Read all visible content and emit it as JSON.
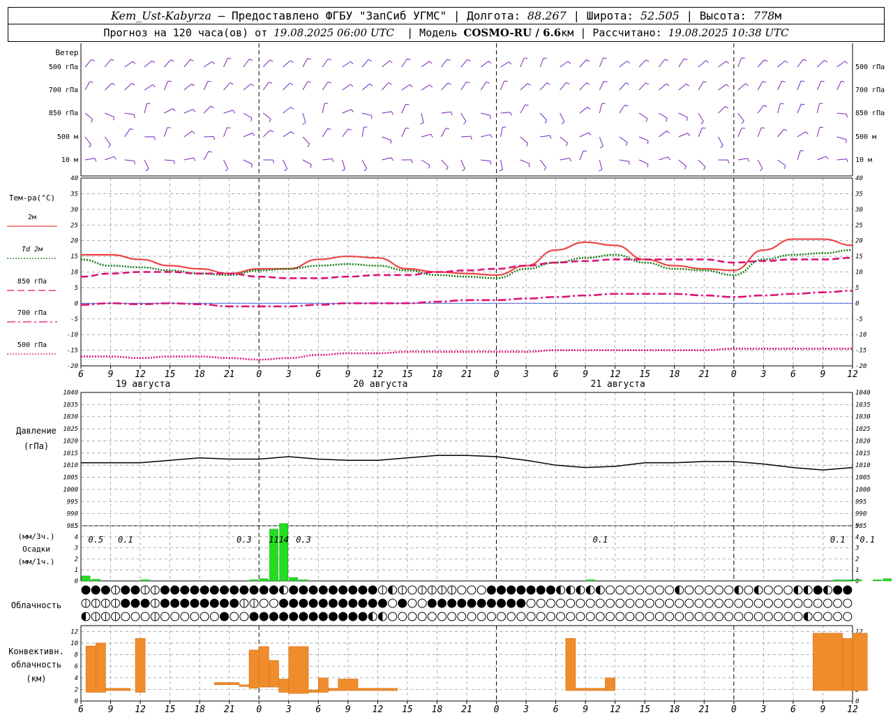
{
  "header": {
    "station": "Kem_Ust-Kabyrza",
    "sep": " – ",
    "provider": "Предоставлено ФГБУ \"ЗапСиб УГМС\"",
    "lon_label": "Долгота:",
    "lon": "88.267",
    "lat_label": "Широта:",
    "lat": "52.505",
    "alt_label": "Высота:",
    "alt": "778",
    "alt_unit": "м",
    "forecast_label": "Прогноз на 120 часа(ов) от",
    "forecast_time": "19.08.2025 06:00 UTC",
    "model_label": "Модель",
    "model": "COSMO-RU / 6.6",
    "model_unit": "км",
    "calc_label": "Рассчитано:",
    "calc_time": "19.08.2025 10:38 UTC"
  },
  "chart_data": [
    {
      "type": "wind-barbs",
      "label": "Ветер",
      "levels": [
        "500 гПа",
        "700 гПа",
        "850 гПа",
        "500 м",
        "10 м"
      ]
    },
    {
      "type": "line",
      "ylabel": "Тем-ра(°C)",
      "ylim": [
        -20,
        40
      ],
      "yticks": [
        -20,
        -15,
        -10,
        -5,
        0,
        5,
        10,
        15,
        20,
        25,
        30,
        35,
        40
      ],
      "x_hours": [
        6,
        9,
        12,
        15,
        18,
        21,
        0,
        3,
        6,
        9,
        12,
        15,
        18,
        21,
        0,
        3,
        6,
        9,
        12,
        15,
        18,
        21,
        0,
        3,
        6,
        9,
        12
      ],
      "dates": [
        {
          "label": "19 августа",
          "x_index": 2
        },
        {
          "label": "20 августа",
          "x_index": 10
        },
        {
          "label": "21 августа",
          "x_index": 18
        }
      ],
      "series": [
        {
          "name": "2м",
          "color": "#ee4444",
          "dash": "solid",
          "values": [
            15.5,
            15.5,
            14,
            12,
            11,
            9.5,
            11,
            11,
            14,
            15,
            14.5,
            11,
            10,
            9.5,
            9,
            12,
            17,
            19.5,
            18.5,
            14,
            12,
            11,
            10.5,
            17,
            20.5,
            20.5,
            18.5
          ]
        },
        {
          "name": "Td  2м",
          "color": "#117711",
          "dash": "dot",
          "values": [
            14,
            12,
            11.5,
            10.5,
            9.5,
            9,
            10.5,
            11,
            12,
            12.5,
            12,
            10.5,
            9,
            8.5,
            8,
            11,
            13,
            14.5,
            15.5,
            13,
            11,
            10.5,
            9,
            14,
            15.5,
            16,
            17
          ]
        },
        {
          "name": "850 гПа",
          "color": "#dd1177",
          "dash": "dash",
          "values": [
            8.5,
            9.5,
            10,
            10,
            9.5,
            9.5,
            8.5,
            8,
            8,
            8.5,
            9,
            9,
            10,
            10.5,
            11,
            12,
            13,
            13.5,
            14,
            14,
            14,
            14,
            13,
            13.5,
            14,
            14,
            14.5
          ]
        },
        {
          "name": "700 гПа",
          "color": "#dd1177",
          "dash": "dashdot",
          "values": [
            -0.5,
            0,
            -0.3,
            0,
            -0.3,
            -1,
            -1,
            -1,
            -0.5,
            0,
            0,
            0,
            0.5,
            1,
            1,
            1.5,
            2,
            2.5,
            3,
            3,
            3,
            2.5,
            2,
            2.5,
            3,
            3.5,
            4
          ]
        },
        {
          "name": "500 гПа",
          "color": "#dd1177",
          "dash": "dot",
          "values": [
            -17,
            -17,
            -17.5,
            -17,
            -17,
            -17.5,
            -18,
            -17.5,
            -16.5,
            -16,
            -16,
            -15.5,
            -15.5,
            -15.5,
            -15.5,
            -15.5,
            -15,
            -15,
            -15,
            -15,
            -15,
            -15,
            -14.5,
            -14.5,
            -14.5,
            -14.5,
            -14.5
          ]
        }
      ]
    },
    {
      "type": "line",
      "ylabel": "Давление",
      "ylabel2": "(гПа)",
      "ylim": [
        985,
        1040
      ],
      "yticks": [
        985,
        990,
        995,
        1000,
        1005,
        1010,
        1015,
        1020,
        1025,
        1030,
        1035,
        1040
      ],
      "series": [
        {
          "name": "pressure",
          "color": "#000000",
          "values": [
            1011,
            1011,
            1011,
            1012,
            1013,
            1012.5,
            1012.5,
            1013.5,
            1012.5,
            1012,
            1012,
            1013,
            1014,
            1014,
            1013.5,
            1012,
            1010,
            1009,
            1009.5,
            1011,
            1011,
            1011.5,
            1011.5,
            1010.5,
            1009,
            1008,
            1009
          ]
        }
      ]
    },
    {
      "type": "bar",
      "ylabel": "(мм/3ч.)",
      "ylabel2": "Осадки",
      "ylabel3": "(мм/1ч.)",
      "ylim": [
        0,
        5
      ],
      "yticks": [
        0,
        1,
        2,
        3,
        4,
        5
      ],
      "bars_hour": [
        {
          "h": 0,
          "v": 0.45
        },
        {
          "h": 1,
          "v": 0.15
        },
        {
          "h": 6,
          "v": 0.1
        },
        {
          "h": 17,
          "v": 0.1
        },
        {
          "h": 18,
          "v": 0.2
        },
        {
          "h": 19,
          "v": 4.7
        },
        {
          "h": 20,
          "v": 5.2
        },
        {
          "h": 21,
          "v": 0.3
        },
        {
          "h": 22,
          "v": 0.1
        },
        {
          "h": 51,
          "v": 0.1
        },
        {
          "h": 76,
          "v": 0.1
        },
        {
          "h": 77,
          "v": 0.1
        },
        {
          "h": 78,
          "v": 0.1
        },
        {
          "h": 80,
          "v": 0.1
        },
        {
          "h": 81,
          "v": 0.2
        }
      ],
      "labels": [
        {
          "h": 1.5,
          "text": "0.5"
        },
        {
          "h": 4.5,
          "text": "0.1"
        },
        {
          "h": 16.5,
          "text": "0.3"
        },
        {
          "h": 19.5,
          "text": "11"
        },
        {
          "h": 20.5,
          "text": "14"
        },
        {
          "h": 22.5,
          "text": "0.3"
        },
        {
          "h": 52.5,
          "text": "0.1"
        },
        {
          "h": 76.5,
          "text": "0.1"
        },
        {
          "h": 79.5,
          "text": "0.1"
        }
      ]
    },
    {
      "type": "table",
      "label": "Облачность",
      "rows": [
        "FFFDFFDDFFFFFFFFFFFFLFFFFFFFFFDLDEDDDDEEEFFFFFFFLLLLLEEEEEEELEEEEELELEEELLFLFFFFE",
        "DDDDFFFDFFFFFFFFDDEEFFFFFFFFFFFEFEEFFFFFFFFFFEEEEEEEEEEEEEEEEEEEEEEEEEEEEEEEEEEEEE",
        "LDDDEEEDEEEEEEFEEFFFFFFFFFFFFLLEEEEEEEEEEEEEEEEEEEEEEEEEEEEEEEEEEEEEEEEEELEEEEFFF"
      ]
    },
    {
      "type": "bar",
      "ylabel": "Конвективн.",
      "ylabel2": "облачность",
      "ylabel3": "(км)",
      "ylim": [
        0,
        13
      ],
      "yticks": [
        0,
        2,
        4,
        6,
        8,
        10,
        12
      ],
      "cells": [
        {
          "h0": 0.5,
          "h1": 1.5,
          "bottom": 1.5,
          "top": 9.5
        },
        {
          "h0": 1.5,
          "h1": 2.5,
          "bottom": 1.5,
          "top": 10
        },
        {
          "h0": 2.5,
          "h1": 5,
          "bottom": 1.8,
          "top": 2.2
        },
        {
          "h0": 5.5,
          "h1": 6.5,
          "bottom": 1.5,
          "top": 10.8
        },
        {
          "h0": 13.5,
          "h1": 16,
          "bottom": 2.8,
          "top": 3.2
        },
        {
          "h0": 16,
          "h1": 17,
          "bottom": 2.5,
          "top": 2.8
        },
        {
          "h0": 17,
          "h1": 18,
          "bottom": 2.2,
          "top": 8.8
        },
        {
          "h0": 18,
          "h1": 19,
          "bottom": 2.4,
          "top": 9.4
        },
        {
          "h0": 19,
          "h1": 20,
          "bottom": 2.4,
          "top": 7
        },
        {
          "h0": 20,
          "h1": 21,
          "bottom": 1.5,
          "top": 3.8
        },
        {
          "h0": 21,
          "h1": 23,
          "bottom": 1.3,
          "top": 9.4
        },
        {
          "h0": 23,
          "h1": 24,
          "bottom": 1.5,
          "top": 1.9
        },
        {
          "h0": 24,
          "h1": 25,
          "bottom": 1.5,
          "top": 4
        },
        {
          "h0": 25,
          "h1": 26,
          "bottom": 1.8,
          "top": 2.2
        },
        {
          "h0": 26,
          "h1": 28,
          "bottom": 1.8,
          "top": 3.8
        },
        {
          "h0": 28,
          "h1": 32,
          "bottom": 1.8,
          "top": 2.2
        },
        {
          "h0": 49,
          "h1": 50,
          "bottom": 1.8,
          "top": 10.8
        },
        {
          "h0": 50,
          "h1": 53,
          "bottom": 1.8,
          "top": 2.2
        },
        {
          "h0": 53,
          "h1": 54,
          "bottom": 1.8,
          "top": 4
        },
        {
          "h0": 74,
          "h1": 77,
          "bottom": 1.8,
          "top": 11.7
        },
        {
          "h0": 77,
          "h1": 78,
          "bottom": 1.8,
          "top": 10.8
        },
        {
          "h0": 78,
          "h1": 79.5,
          "bottom": 1.8,
          "top": 11.7
        }
      ]
    }
  ],
  "colors": {
    "wind": "#7722bb",
    "grid": "#999999",
    "accent": "#f08c2c",
    "rain": "#22dd22"
  }
}
